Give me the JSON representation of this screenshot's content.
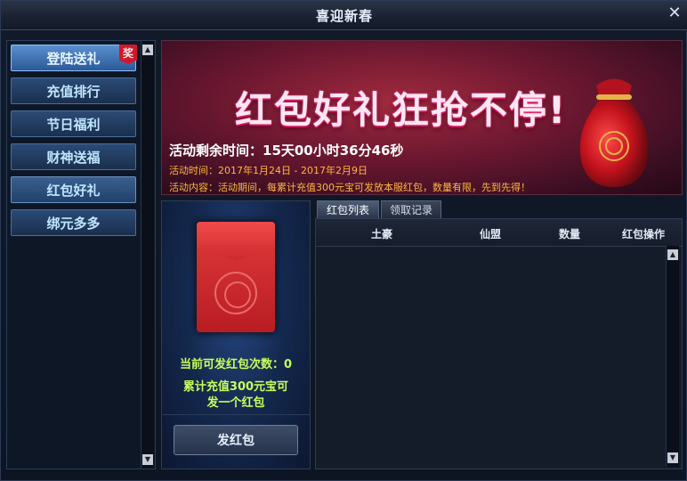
{
  "window": {
    "title": "喜迎新春",
    "close_glyph": "✕"
  },
  "nav": {
    "items": [
      {
        "label": "登陆送礼",
        "badge": "奖"
      },
      {
        "label": "充值排行"
      },
      {
        "label": "节日福利"
      },
      {
        "label": "财神送福"
      },
      {
        "label": "红包好礼"
      },
      {
        "label": "绑元多多"
      }
    ]
  },
  "banner": {
    "title": "红包好礼狂抢不停!",
    "countdown": "活动剩余时间：15天00小时36分46秒",
    "time": "活动时间：2017年1月24日 - 2017年2月9日",
    "content": "活动内容：活动期间，每累计充值300元宝可发放本服红包，数量有限，先到先得！"
  },
  "redpacket": {
    "count_label": "当前可发红包次数：0",
    "rule_line1": "累计充值300元宝可",
    "rule_line2": "发一个红包",
    "send_button": "发红包"
  },
  "tabs": [
    {
      "label": "红包列表"
    },
    {
      "label": "领取记录"
    }
  ],
  "table": {
    "columns": [
      "土豪",
      "仙盟",
      "数量",
      "红包操作"
    ]
  },
  "colors": {
    "accent_green": "#c8ff5a",
    "countdown_white": "#ffffff",
    "info_orange": "#ffb640"
  }
}
